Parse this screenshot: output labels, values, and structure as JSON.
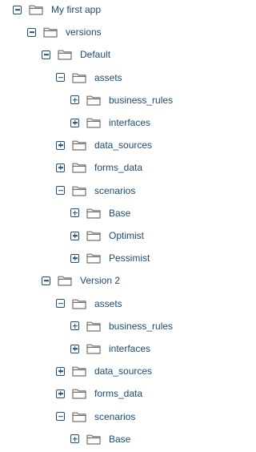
{
  "tree": [
    {
      "label": "My first app",
      "depth": 0,
      "expanded": true,
      "icon": "folder-icon"
    },
    {
      "label": "versions",
      "depth": 1,
      "expanded": true,
      "icon": "folder-icon"
    },
    {
      "label": "Default",
      "depth": 2,
      "expanded": true,
      "icon": "folder-icon"
    },
    {
      "label": "assets",
      "depth": 3,
      "expanded": true,
      "icon": "folder-icon"
    },
    {
      "label": "business_rules",
      "depth": 4,
      "expanded": false,
      "icon": "folder-icon"
    },
    {
      "label": "interfaces",
      "depth": 4,
      "expanded": false,
      "icon": "folder-icon"
    },
    {
      "label": "data_sources",
      "depth": 3,
      "expanded": false,
      "icon": "folder-icon"
    },
    {
      "label": "forms_data",
      "depth": 3,
      "expanded": false,
      "icon": "folder-icon"
    },
    {
      "label": "scenarios",
      "depth": 3,
      "expanded": true,
      "icon": "folder-icon"
    },
    {
      "label": "Base",
      "depth": 4,
      "expanded": false,
      "icon": "folder-icon"
    },
    {
      "label": "Optimist",
      "depth": 4,
      "expanded": false,
      "icon": "folder-icon"
    },
    {
      "label": "Pessimist",
      "depth": 4,
      "expanded": false,
      "icon": "folder-icon"
    },
    {
      "label": "Version 2",
      "depth": 2,
      "expanded": true,
      "icon": "folder-icon"
    },
    {
      "label": "assets",
      "depth": 3,
      "expanded": true,
      "icon": "folder-icon"
    },
    {
      "label": "business_rules",
      "depth": 4,
      "expanded": false,
      "icon": "folder-icon"
    },
    {
      "label": "interfaces",
      "depth": 4,
      "expanded": false,
      "icon": "folder-icon"
    },
    {
      "label": "data_sources",
      "depth": 3,
      "expanded": false,
      "icon": "folder-icon"
    },
    {
      "label": "forms_data",
      "depth": 3,
      "expanded": false,
      "icon": "folder-icon"
    },
    {
      "label": "scenarios",
      "depth": 3,
      "expanded": true,
      "icon": "folder-icon"
    },
    {
      "label": "Base",
      "depth": 4,
      "expanded": false,
      "icon": "folder-icon"
    }
  ],
  "colors": {
    "text": "#1b4a73",
    "toggle": "#1f4e79",
    "folder_outline": "#707070",
    "background": "#ffffff"
  }
}
